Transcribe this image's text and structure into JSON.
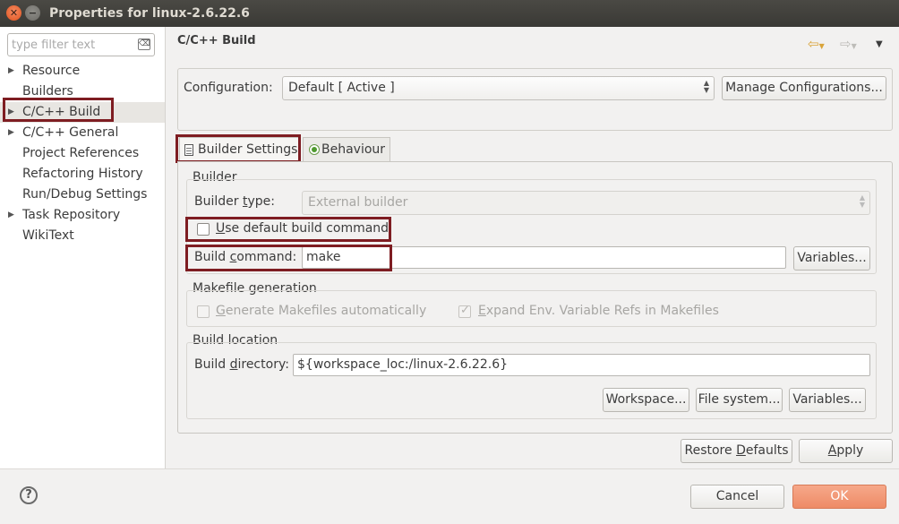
{
  "window": {
    "title": "Properties for linux-2.6.22.6",
    "close_glyph": "✕",
    "minimize_glyph": "−"
  },
  "sidebar": {
    "filter_placeholder": "type filter text",
    "clear_glyph": "⌫",
    "items": [
      {
        "label": "Resource",
        "expandable": true
      },
      {
        "label": "Builders",
        "expandable": false
      },
      {
        "label": "C/C++ Build",
        "expandable": true,
        "selected": true
      },
      {
        "label": "C/C++ General",
        "expandable": true
      },
      {
        "label": "Project References",
        "expandable": false
      },
      {
        "label": "Refactoring History",
        "expandable": false
      },
      {
        "label": "Run/Debug Settings",
        "expandable": false
      },
      {
        "label": "Task Repository",
        "expandable": true
      },
      {
        "label": "WikiText",
        "expandable": false
      }
    ]
  },
  "page": {
    "title": "C/C++ Build",
    "nav_back_icon": "back-arrow-icon",
    "nav_forward_icon": "forward-arrow-icon",
    "view_menu_icon": "view-menu-icon"
  },
  "configuration": {
    "label": "Configuration:",
    "value": "Default  [ Active ]",
    "manage_button": "Manage Configurations..."
  },
  "tabs": [
    {
      "label": "Builder Settings",
      "active": true
    },
    {
      "label": "Behaviour",
      "active": false
    }
  ],
  "builder": {
    "group_title": "Builder",
    "type_label_pre": "Builder ",
    "type_label_ul": "t",
    "type_label_post": "ype:",
    "type_value": "External builder",
    "use_default_ul": "U",
    "use_default_rest": "se default build command",
    "use_default_checked": false,
    "command_label_pre": "Build ",
    "command_label_ul": "c",
    "command_label_post": "ommand:",
    "command_value": "make",
    "variables_button": "Variables..."
  },
  "makefile": {
    "group_title": "Makefile generation",
    "generate_ul": "G",
    "generate_rest": "enerate Makefiles automatically",
    "generate_checked": false,
    "expand_ul": "E",
    "expand_rest": "xpand Env. Variable Refs in Makefiles",
    "expand_checked": true
  },
  "location": {
    "group_title": "Build location",
    "dir_label_pre": "Build ",
    "dir_label_ul": "d",
    "dir_label_post": "irectory:",
    "dir_value": "${workspace_loc:/linux-2.6.22.6}",
    "workspace_button": "Workspace...",
    "filesystem_button": "File system...",
    "variables_button": "Variables..."
  },
  "footer": {
    "restore_pre": "Restore ",
    "restore_ul": "D",
    "restore_post": "efaults",
    "apply_ul": "A",
    "apply_rest": "pply",
    "cancel_label": "Cancel",
    "ok_label": "OK",
    "help_glyph": "?"
  },
  "colors": {
    "highlight_border": "#7e1d22",
    "ok_button": "#ee8b66",
    "title_bar": "#3f3e3a"
  }
}
